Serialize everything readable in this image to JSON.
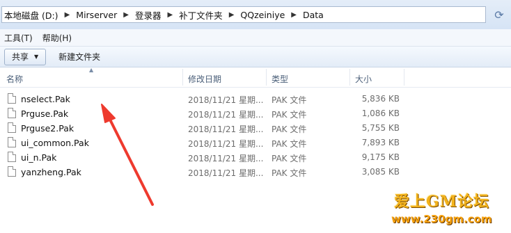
{
  "address": {
    "crumbs": [
      "本地磁盘 (D:)",
      "Mirserver",
      "登录器",
      "补丁文件夹",
      "QQzeiniye",
      "Data"
    ]
  },
  "menu": [
    "工具(T)",
    "帮助(H)"
  ],
  "toolbar": {
    "share_label": "共享",
    "new_folder_label": "新建文件夹"
  },
  "columns": {
    "name": "名称",
    "date": "修改日期",
    "type": "类型",
    "size": "大小"
  },
  "files": [
    {
      "name": "nselect.Pak",
      "date": "2018/11/21 星期...",
      "type": "PAK 文件",
      "size": "5,836 KB"
    },
    {
      "name": "Prguse.Pak",
      "date": "2018/11/21 星期...",
      "type": "PAK 文件",
      "size": "1,086 KB"
    },
    {
      "name": "Prguse2.Pak",
      "date": "2018/11/21 星期...",
      "type": "PAK 文件",
      "size": "5,755 KB"
    },
    {
      "name": "ui_common.Pak",
      "date": "2018/11/21 星期...",
      "type": "PAK 文件",
      "size": "7,893 KB"
    },
    {
      "name": "ui_n.Pak",
      "date": "2018/11/21 星期...",
      "type": "PAK 文件",
      "size": "9,175 KB"
    },
    {
      "name": "yanzheng.Pak",
      "date": "2018/11/21 星期...",
      "type": "PAK 文件",
      "size": "3,085 KB"
    }
  ],
  "watermark": {
    "title": "爱上GM论坛",
    "url": "www.230gm.com"
  },
  "colors": {
    "annotation_arrow": "#ee3a2e",
    "watermark": "#f2b21c"
  }
}
